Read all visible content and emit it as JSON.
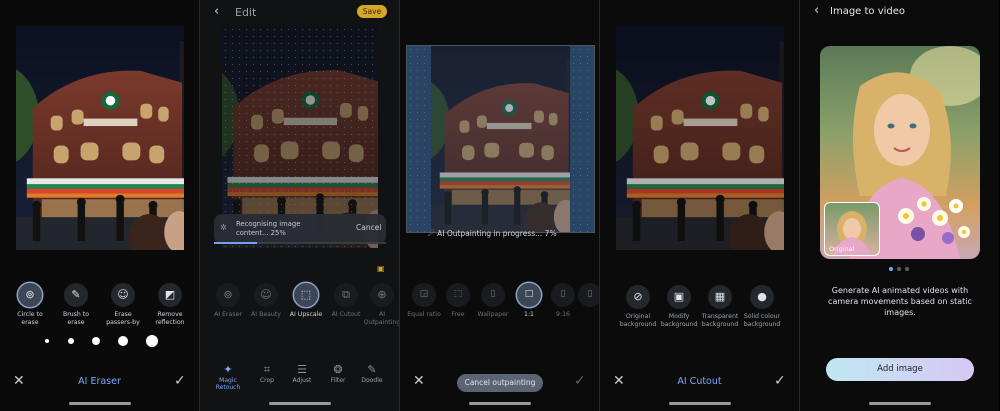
{
  "panel1": {
    "tools": [
      {
        "label": "Circle to erase",
        "icon": "circle-erase-icon"
      },
      {
        "label": "Brush to erase",
        "icon": "brush-icon"
      },
      {
        "label": "Erase passers-by",
        "icon": "people-icon"
      },
      {
        "label": "Remove reflection",
        "icon": "reflection-icon"
      }
    ],
    "brush_sizes": 5,
    "title": "AI Eraser"
  },
  "panel2": {
    "header": {
      "title": "Edit",
      "save": "Save"
    },
    "progress_text": "Recognising image content... 25%",
    "cancel": "Cancel",
    "progress": 0.25,
    "tools": [
      {
        "label": "AI Eraser"
      },
      {
        "label": "AI Beauty"
      },
      {
        "label": "AI Upscale"
      },
      {
        "label": "AI Cutout"
      },
      {
        "label": "AI Outpainting"
      }
    ],
    "nav": [
      {
        "label": "Magic Retouch",
        "icon": "magic-icon"
      },
      {
        "label": "Crop",
        "icon": "crop-icon"
      },
      {
        "label": "Adjust",
        "icon": "sliders-icon"
      },
      {
        "label": "Filter",
        "icon": "filter-icon"
      },
      {
        "label": "Doodle",
        "icon": "pen-icon"
      }
    ]
  },
  "panel3": {
    "progress_text": "AI Outpainting in progress... 7%",
    "progress": 0.07,
    "ratios": [
      {
        "label": "Equal ratio"
      },
      {
        "label": "Free"
      },
      {
        "label": "Wallpaper"
      },
      {
        "label": "1:1"
      },
      {
        "label": "9:16"
      }
    ],
    "cancel_button": "Cancel outpainting"
  },
  "panel4": {
    "options": [
      {
        "label": "Original background"
      },
      {
        "label": "Modify background"
      },
      {
        "label": "Transparent background"
      },
      {
        "label": "Solid colour background"
      }
    ],
    "title": "AI Cutout"
  },
  "panel5": {
    "header": {
      "title": "Image to video"
    },
    "original_label": "Original",
    "description": "Generate AI animated videos with camera movements based on static images.",
    "add_button": "Add image",
    "pages": 3,
    "active_page": 0
  },
  "colors": {
    "accent_blue": "#7aa7ff",
    "save_yellow": "#d4a62a",
    "add_gradient_start": "#bfe7f2",
    "add_gradient_end": "#d8c8f5"
  }
}
